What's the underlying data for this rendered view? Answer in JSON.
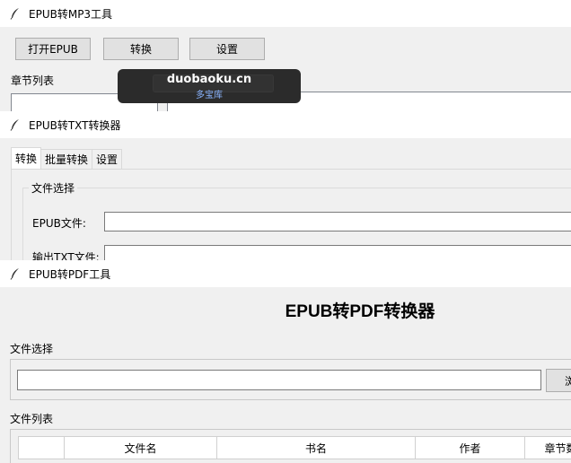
{
  "win_mp3": {
    "title": "EPUB转MP3工具",
    "buttons": {
      "open": "打开EPUB",
      "convert": "转换",
      "settings": "设置"
    },
    "chapter_list_label": "章节列表"
  },
  "overlay": {
    "main": "duobaoku.cn",
    "sub": "多宝库"
  },
  "win_txt": {
    "title": "EPUB转TXT转换器",
    "tabs": [
      "转换",
      "批量转换",
      "设置"
    ],
    "group_title": "文件选择",
    "epub_file_label": "EPUB文件:",
    "output_txt_label": "输出TXT文件:"
  },
  "win_pdf": {
    "title": "EPUB转PDF工具",
    "heading": "EPUB转PDF转换器",
    "file_select_label": "文件选择",
    "file_list_label": "文件列表",
    "browse_btn_partial": "浏",
    "table_headers": [
      "",
      "文件名",
      "书名",
      "作者",
      "章节数"
    ]
  },
  "colors": {
    "titlebar_bg": "#ffffff",
    "window_bg": "#f0f0f0",
    "overlay_bg": "#2b2b2b",
    "overlay_sub": "#8ab4ff"
  }
}
